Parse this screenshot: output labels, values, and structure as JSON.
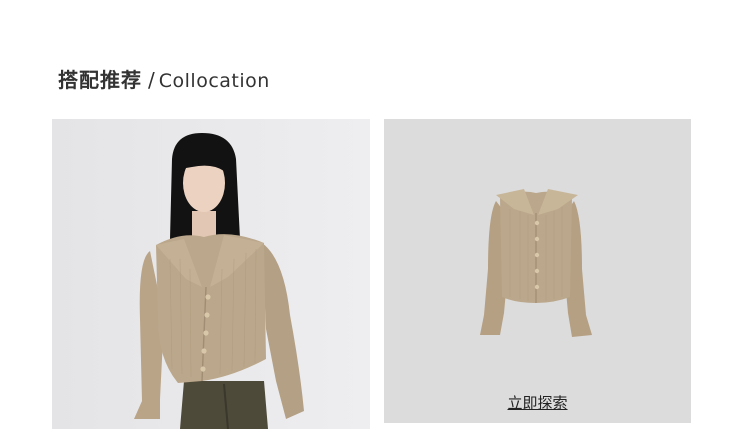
{
  "section": {
    "title_zh": "搭配推荐",
    "separator": "/",
    "title_en": "Collocation"
  },
  "products": [
    {
      "image": "model-wearing-khaki-ribbed-cardigan"
    },
    {
      "image": "khaki-ribbed-cardigan-flatlay",
      "cta_label": "立即探索"
    }
  ],
  "colors": {
    "cardigan": "#b9a488",
    "model_bg": "#e8e8ea",
    "product_bg": "#dcdcdc"
  }
}
